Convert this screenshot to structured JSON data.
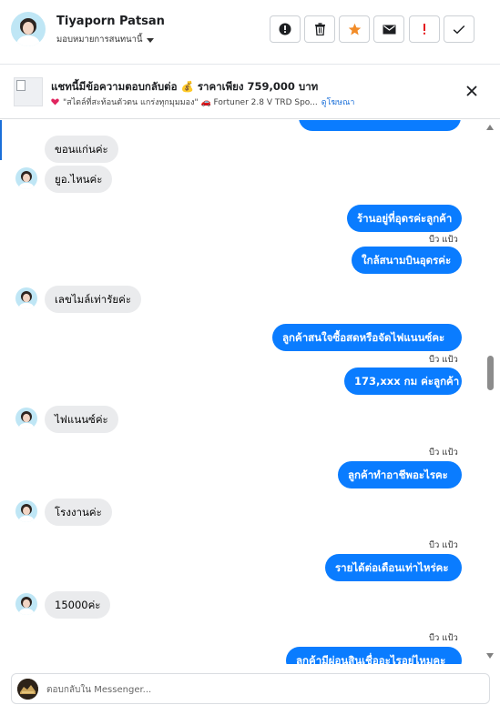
{
  "header": {
    "name": "Tiyaporn Patsan",
    "assign_label": "มอบหมายการสนทนานี้",
    "actions": [
      "info-icon",
      "trash-icon",
      "star-icon",
      "mail-icon",
      "exclamation-icon",
      "check-icon"
    ]
  },
  "ad": {
    "title": "แชทนี้มีข้อความตอบกลับต่อ 💰 ราคาเพียง 759,000 บาท",
    "subtitle": "\"สไตล์ที่สะท้อนตัวตน แกร่งทุกมุมมอง\" 🚗 Fortuner 2.8 V TRD Spo...",
    "link": "ดูโฆษณา"
  },
  "messages": [
    {
      "dir": "out",
      "text": ""
    },
    {
      "dir": "in",
      "text": "ขอนแก่นค่ะ"
    },
    {
      "dir": "in",
      "text": "ยูอ.ไหนค่ะ"
    },
    {
      "dir": "out",
      "text": "ร้านอยู่ที่อุดรค่ะลูกค้า",
      "seen": "บีว แป้ว"
    },
    {
      "dir": "out",
      "text": "ใกล้สนามบินอุดรค่ะ"
    },
    {
      "dir": "in",
      "text": "เลขไมล์เท่ารัยค่ะ"
    },
    {
      "dir": "out",
      "text": "ลูกค้าสนใจซื้อสดหรือจัดไฟแนนซ์คะ",
      "seen": "บีว แป้ว"
    },
    {
      "dir": "out",
      "text": "173,xxx  กม ค่ะลูกค้า"
    },
    {
      "dir": "in",
      "text": "ไฟแนนซ์ค่ะ"
    },
    {
      "dir": "out",
      "text": "ลูกค้าทำอาชีพอะไรคะ",
      "seen": "บีว แป้ว"
    },
    {
      "dir": "in",
      "text": "โรงงานค่ะ"
    },
    {
      "dir": "out",
      "text": "รายได้ต่อเดือนเท่าไหร่คะ",
      "seen": "บีว แป้ว"
    },
    {
      "dir": "in",
      "text": "15000ค่ะ"
    },
    {
      "dir": "out",
      "text": "ลูกค้ามีผ่อนสินเชื่ออะไรอยู่ไหมคะ",
      "seen": "บีว แป้ว"
    }
  ],
  "composer": {
    "placeholder": "ตอบกลับใน Messenger..."
  },
  "colors": {
    "outgoing_bubble": "#0a7cff",
    "incoming_bubble": "#eaebed",
    "important_icon": "#e4181e",
    "star_icon": "#f28c28"
  }
}
